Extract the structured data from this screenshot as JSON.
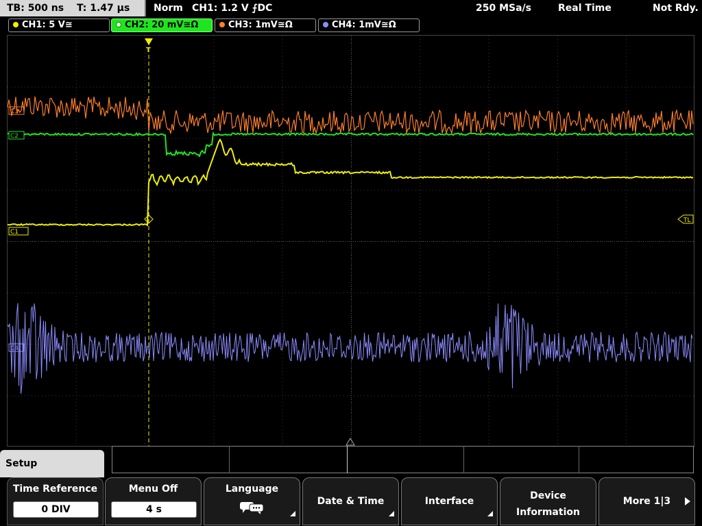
{
  "topbar": {
    "timebase": "TB: 500 ns",
    "trigger_time": "T: 1.47 µs",
    "mode": "Norm",
    "trigger": "CH1: 1.2 V ⨍DC",
    "sample_rate": "250 MSa/s",
    "acq_mode": "Real Time",
    "status": "Not Rdy."
  },
  "channels": [
    {
      "label": "CH1: 5 V≅",
      "color": "#f0f000"
    },
    {
      "label": "CH2: 20 mV≅Ω",
      "color": "#1ee61e"
    },
    {
      "label": "CH3: 1mV≅Ω",
      "color": "#ff7f2a"
    },
    {
      "label": "CH4: 1mV≅Ω",
      "color": "#8c8cff"
    }
  ],
  "markers": {
    "c1": "C1",
    "c2": "C2",
    "c3": "C3",
    "c4": "C4",
    "trigger_level": "TL",
    "trigger_pos": "T"
  },
  "softkeys": {
    "setup": "Setup",
    "time_reference": {
      "label": "Time Reference",
      "value": "0 DIV"
    },
    "menu_off": {
      "label": "Menu Off",
      "value": "4 s"
    },
    "language": {
      "label": "Language"
    },
    "date_time": {
      "label": "Date & Time"
    },
    "interface": {
      "label": "Interface"
    },
    "device_info": {
      "line1": "Device",
      "line2": "Information"
    },
    "more": {
      "label": "More 1|3"
    }
  }
}
